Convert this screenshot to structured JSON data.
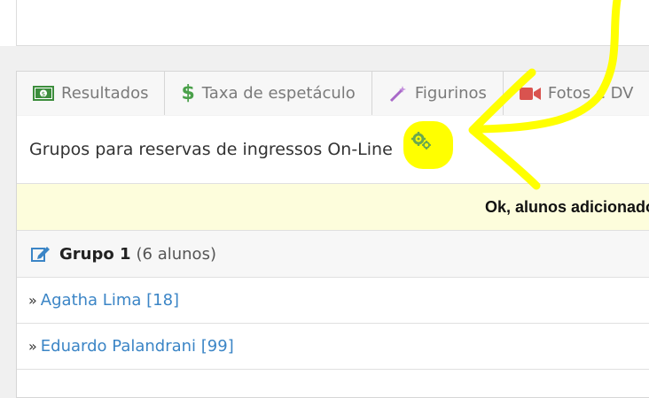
{
  "tabs": [
    {
      "label": "Resultados",
      "icon": "money-icon"
    },
    {
      "label": "Taxa de espetáculo",
      "icon": "dollar-icon"
    },
    {
      "label": "Figurinos",
      "icon": "magic-wand-icon"
    },
    {
      "label": "Fotos e DV",
      "icon": "video-camera-icon"
    }
  ],
  "heading": {
    "text": "Grupos para reservas de ingressos On-Line",
    "icon": "gears-icon"
  },
  "alert": {
    "text": "Ok, alunos adicionado"
  },
  "group": {
    "name": "Grupo 1",
    "count": "(6 alunos)",
    "icon": "edit-icon"
  },
  "members": [
    {
      "prefix": "»",
      "name": "Agatha Lima [18]"
    },
    {
      "prefix": "»",
      "name": "Eduardo Palandrani [99]"
    }
  ],
  "colors": {
    "link": "#3b85c6",
    "alert_bg": "#fdfddc",
    "highlight": "#ffff00",
    "gear": "#6aa84f"
  }
}
